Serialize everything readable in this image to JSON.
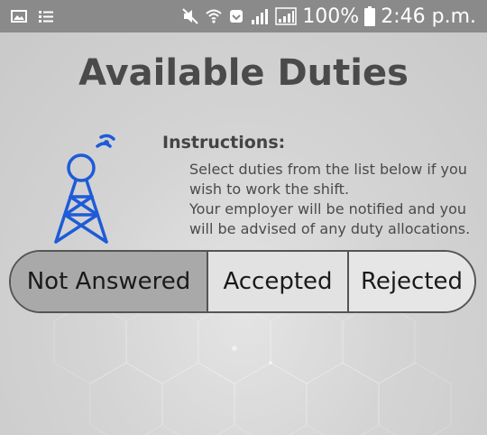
{
  "status_bar": {
    "icons_left": [
      "image-icon",
      "list-icon"
    ],
    "icons_right": [
      "mute-icon",
      "wifi-icon",
      "data-icon",
      "signal-icon",
      "signal-icon",
      "battery-icon"
    ],
    "battery": "100%",
    "time": "2:46 p.m."
  },
  "header": {
    "title": "Available Duties"
  },
  "instructions": {
    "heading": "Instructions:",
    "lines": [
      "Select duties from the list below if you",
      "wish to work the shift.",
      "Your employer will be notified and you",
      "will be advised of any duty allocations."
    ]
  },
  "tabs": [
    {
      "label": "Not Answered",
      "selected": true
    },
    {
      "label": "Accepted",
      "selected": false
    },
    {
      "label": "Rejected",
      "selected": false
    }
  ],
  "colors": {
    "status_bar": "#8a8a8a",
    "title": "#4a4a4a",
    "tower": "#1e5bd8",
    "tab_selected": "#a9a9a9"
  }
}
